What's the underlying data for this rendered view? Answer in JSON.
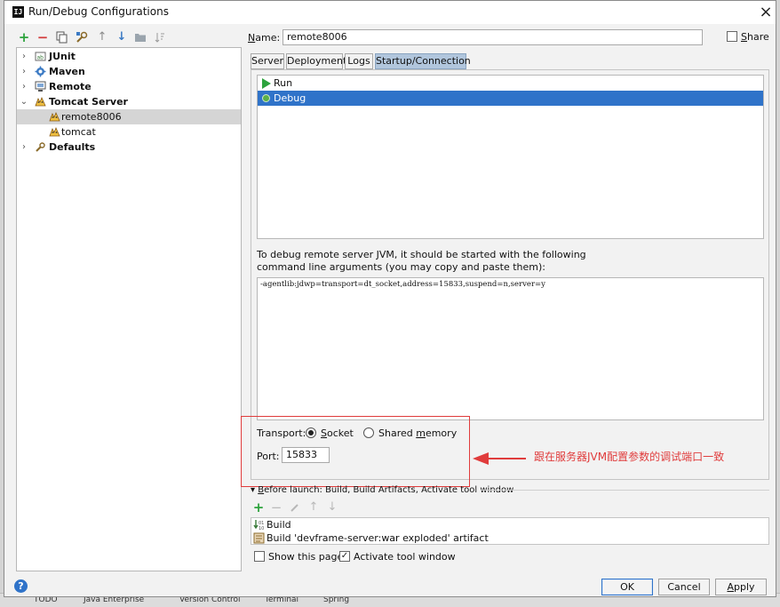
{
  "window": {
    "title": "Run/Debug Configurations",
    "app_icon": "IJ",
    "close": "×"
  },
  "toolbar": {
    "icons": [
      "add-icon",
      "remove-icon",
      "copy-icon",
      "wrench-icon",
      "move-up-icon",
      "move-down-icon",
      "folder-icon",
      "sort-icon"
    ],
    "glyphs": {
      "add": "+",
      "remove": "−",
      "up": "↑",
      "down": "↓"
    },
    "colors": {
      "add": "#2da33d",
      "remove": "#d23b3b",
      "arrows": "#3b7ac4"
    }
  },
  "tree": {
    "items": [
      {
        "label": "JUnit",
        "arrow": "›",
        "icon": "junit-icon"
      },
      {
        "label": "Maven",
        "arrow": "›",
        "icon": "maven-icon"
      },
      {
        "label": "Remote",
        "arrow": "›",
        "icon": "remote-icon"
      },
      {
        "label": "Tomcat Server",
        "arrow": "⌄",
        "icon": "tomcat-icon"
      },
      {
        "label": "remote8006",
        "icon": "tomcat-icon",
        "selected": true
      },
      {
        "label": "tomcat",
        "icon": "tomcat-icon"
      },
      {
        "label": "Defaults",
        "arrow": "›",
        "icon": "defaults-icon"
      }
    ]
  },
  "name_field": {
    "label_prefix": "N",
    "label_rest": "ame:",
    "value": "remote8006"
  },
  "share": {
    "prefix": "S",
    "rest": "hare",
    "checked": false
  },
  "tabs": [
    "Server",
    "Deployment",
    "Logs",
    "Startup/Connection"
  ],
  "active_tab": "Startup/Connection",
  "modes": [
    {
      "label": "Run",
      "selected": false
    },
    {
      "label": "Debug",
      "selected": true
    }
  ],
  "description": {
    "line1": "To debug remote server JVM, it should be started with the following",
    "line2": "command line arguments (you may copy and paste them):"
  },
  "jvm_args": "-agentlib:jdwp=transport=dt_socket,address=15833,suspend=n,server=y",
  "transport": {
    "label": "Transport:",
    "socket_prefix": "S",
    "socket_rest": "ocket",
    "shared_prefix": "Shared ",
    "shared_underlined": "m",
    "shared_rest": "emory",
    "selected": "Socket"
  },
  "port": {
    "label": "Port:",
    "value": "15833"
  },
  "annotation": {
    "text": "跟在服务器JVM配置参数的调试端口一致",
    "color": "#e03c3c"
  },
  "before_launch": {
    "arrow": "▾",
    "prefix": "B",
    "text": "efore launch: Build, Build Artifacts, Activate tool window",
    "items": [
      "Build",
      "Build 'devframe-server:war exploded' artifact"
    ]
  },
  "options": {
    "show_page": {
      "label": "Show this page",
      "checked": false
    },
    "activate": {
      "label": "Activate tool window",
      "checked": true
    }
  },
  "buttons": {
    "ok": "OK",
    "cancel": "Cancel",
    "apply_prefix": "A",
    "apply_rest": "pply"
  },
  "help": "?",
  "ide_bottom": [
    "TODO",
    "Java Enterprise",
    "Version Control",
    "Terminal",
    "Spring"
  ]
}
